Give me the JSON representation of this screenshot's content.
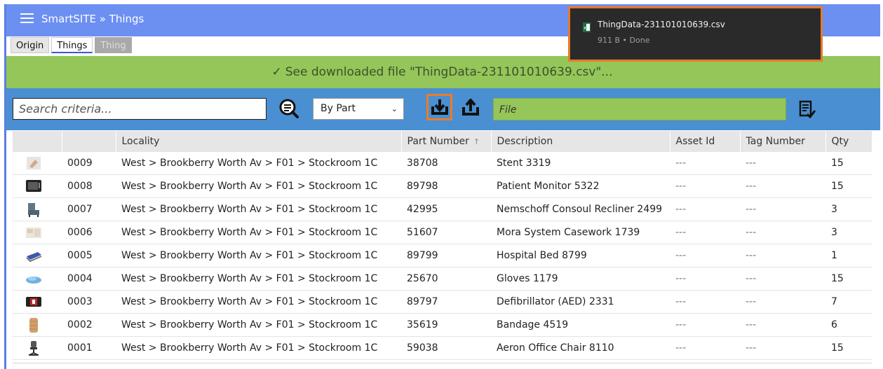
{
  "app": {
    "title": "SmartSITE » Things"
  },
  "tabs": [
    {
      "label": "Origin",
      "state": "normal"
    },
    {
      "label": "Things",
      "state": "active"
    },
    {
      "label": "Thing",
      "state": "disabled"
    }
  ],
  "notice": {
    "check": "✓",
    "text": "See downloaded file \"ThingData-231101010639.csv\"..."
  },
  "toolbar": {
    "search_placeholder": "Search criteria...",
    "filter_mode": "By Part",
    "file_placeholder": "File"
  },
  "download": {
    "filename": "ThingData-231101010639.csv",
    "meta": "911 B • Done"
  },
  "table": {
    "columns": [
      "",
      "",
      "Locality",
      "Part Number",
      "Description",
      "Asset Id",
      "Tag Number",
      "Qty"
    ],
    "sort_indicator": "↑",
    "rows": [
      {
        "icon": "stent-icon",
        "id": "0009",
        "locality": "West > Brookberry Worth Av > F01 > Stockroom 1C",
        "part": "38708",
        "desc": "Stent 3319",
        "asset": "---",
        "tag": "---",
        "qty": "15"
      },
      {
        "icon": "patient-monitor-icon",
        "id": "0008",
        "locality": "West > Brookberry Worth Av > F01 > Stockroom 1C",
        "part": "89798",
        "desc": "Patient Monitor 5322",
        "asset": "---",
        "tag": "---",
        "qty": "15"
      },
      {
        "icon": "recliner-icon",
        "id": "0007",
        "locality": "West > Brookberry Worth Av > F01 > Stockroom 1C",
        "part": "42995",
        "desc": "Nemschoff Consoul Recliner 2499",
        "asset": "---",
        "tag": "---",
        "qty": "3"
      },
      {
        "icon": "casework-icon",
        "id": "0006",
        "locality": "West > Brookberry Worth Av > F01 > Stockroom 1C",
        "part": "51607",
        "desc": "Mora System Casework 1739",
        "asset": "---",
        "tag": "---",
        "qty": "3"
      },
      {
        "icon": "hospital-bed-icon",
        "id": "0005",
        "locality": "West > Brookberry Worth Av > F01 > Stockroom 1C",
        "part": "89799",
        "desc": "Hospital Bed 8799",
        "asset": "---",
        "tag": "---",
        "qty": "1"
      },
      {
        "icon": "gloves-icon",
        "id": "0004",
        "locality": "West > Brookberry Worth Av > F01 > Stockroom 1C",
        "part": "25670",
        "desc": "Gloves 1179",
        "asset": "---",
        "tag": "---",
        "qty": "15"
      },
      {
        "icon": "defibrillator-icon",
        "id": "0003",
        "locality": "West > Brookberry Worth Av > F01 > Stockroom 1C",
        "part": "89797",
        "desc": "Defibrillator (AED) 2331",
        "asset": "---",
        "tag": "---",
        "qty": "7"
      },
      {
        "icon": "bandage-icon",
        "id": "0002",
        "locality": "West > Brookberry Worth Av > F01 > Stockroom 1C",
        "part": "35619",
        "desc": "Bandage 4519",
        "asset": "---",
        "tag": "---",
        "qty": "6"
      },
      {
        "icon": "office-chair-icon",
        "id": "0001",
        "locality": "West > Brookberry Worth Av > F01 > Stockroom 1C",
        "part": "59038",
        "desc": "Aeron Office Chair 8110",
        "asset": "---",
        "tag": "---",
        "qty": "15"
      }
    ]
  },
  "colors": {
    "header": "#6c8ff2",
    "notice": "#94c659",
    "toolbar": "#4a8fd1",
    "highlight": "#e87d2a"
  }
}
